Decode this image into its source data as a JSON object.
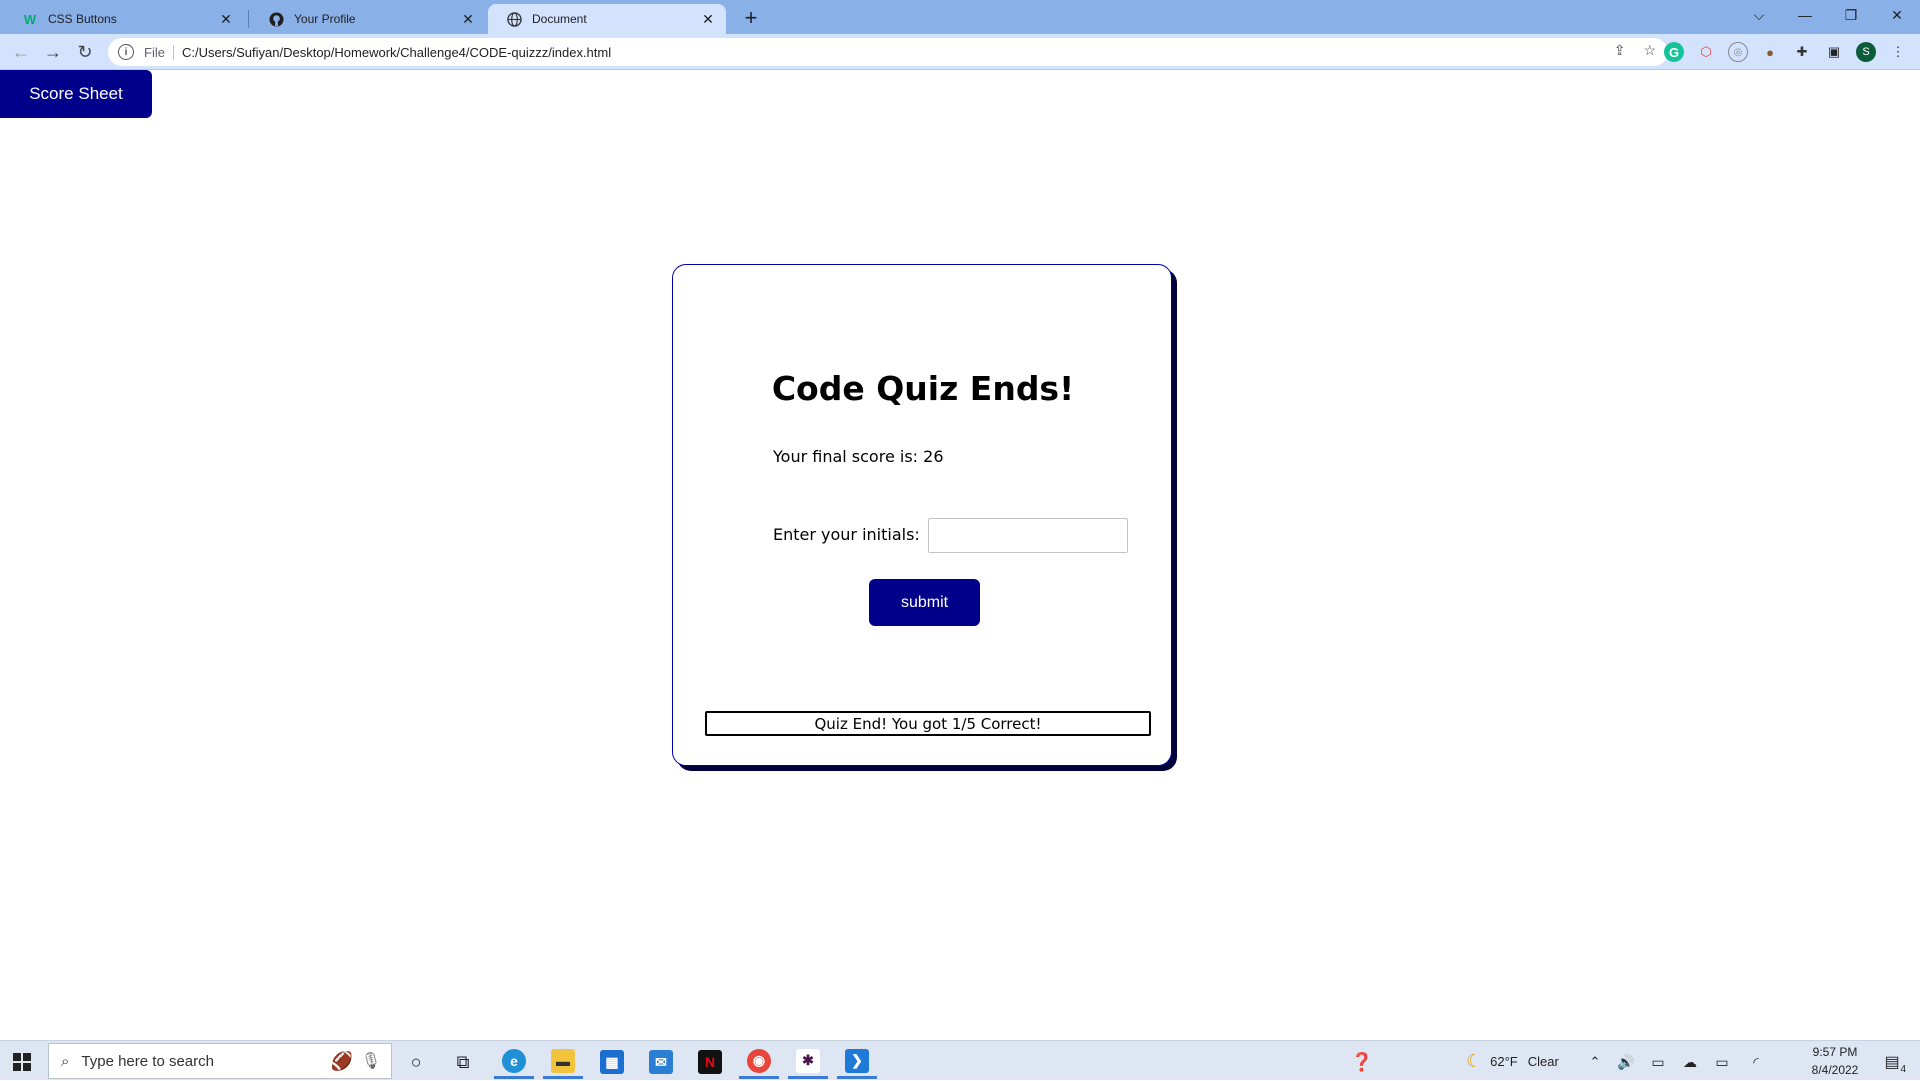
{
  "browser": {
    "tabs": [
      {
        "label": "CSS Buttons",
        "icon": "w3schools-icon"
      },
      {
        "label": "Your Profile",
        "icon": "github-icon"
      },
      {
        "label": "Document",
        "icon": "globe-icon"
      }
    ],
    "address": {
      "scheme_label": "File",
      "url": "C:/Users/Sufiyan/Desktop/Homework/Challenge4/CODE-quizzz/index.html"
    },
    "profile_initial": "S"
  },
  "page": {
    "score_sheet_label": "Score Sheet",
    "title": "Code Quiz Ends!",
    "final_score_text": "Your final score is: 26",
    "initials_label": "Enter your initials:",
    "initials_value": "",
    "submit_label": "submit",
    "result_text": "Quiz End! You got 1/5 Correct!",
    "accent_color": "#00008b"
  },
  "taskbar": {
    "search_placeholder": "Type here to search",
    "weather": {
      "temp": "62°F",
      "condition": "Clear"
    },
    "clock": {
      "time": "9:57 PM",
      "date": "8/4/2022"
    },
    "notification_count": "4"
  }
}
